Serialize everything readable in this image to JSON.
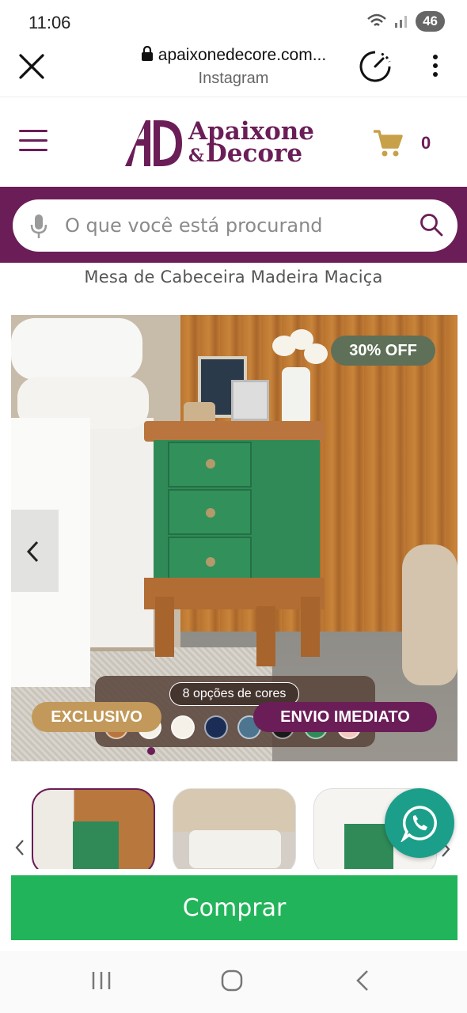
{
  "status_bar": {
    "time": "11:06",
    "battery": "46"
  },
  "browser": {
    "url": "apaixonedecore.com...",
    "source": "Instagram"
  },
  "site": {
    "logo_line1": "Apaixone",
    "logo_amp": "&",
    "logo_line2": "Decore",
    "cart_count": "0",
    "brand_color": "#6b1d57"
  },
  "search": {
    "placeholder": "O que você está procurand"
  },
  "product": {
    "title": "Mesa de Cabeceira Madeira Maciça",
    "discount_badge": "30% OFF",
    "colors_label": "8 opções de cores",
    "tag_exclusive": "EXCLUSIVO",
    "tag_shipping": "ENVIO IMEDIATO",
    "swatch_colors": [
      "#b9753d",
      "#f4f1ea",
      "#f5f1e8",
      "#1c2d55",
      "#4e7590",
      "#1a1a1a",
      "#2f8a57",
      "#f1c9c0"
    ]
  },
  "actions": {
    "buy_label": "Comprar",
    "buy_color": "#22b45a"
  }
}
